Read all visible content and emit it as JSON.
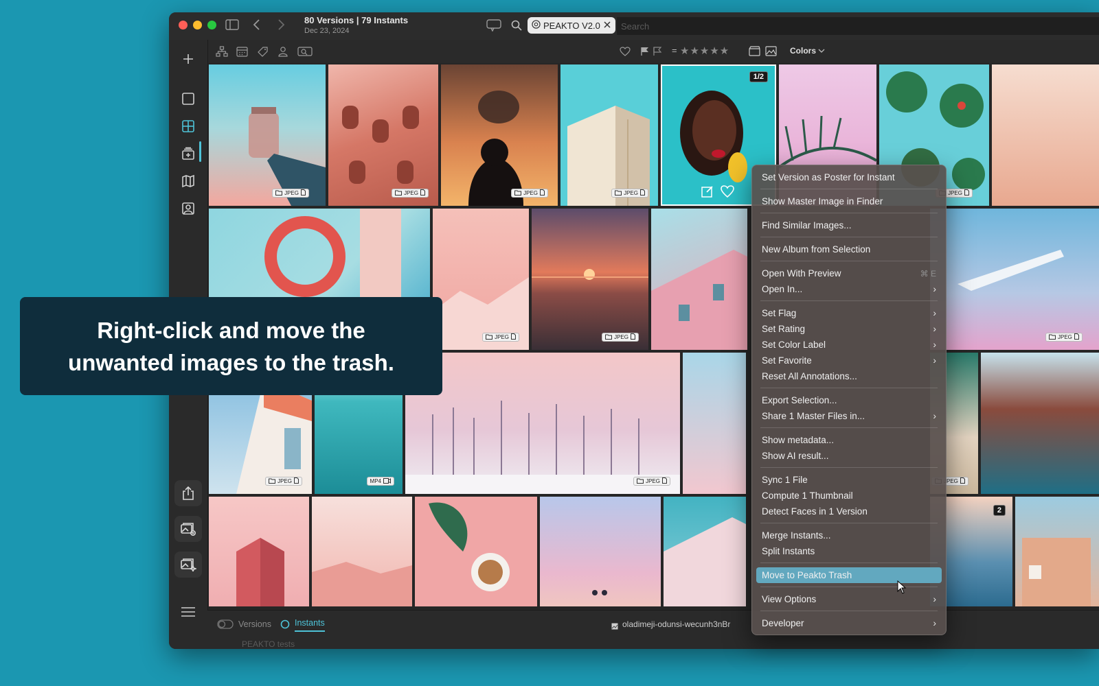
{
  "titlebar": {
    "title": "80 Versions | 79 Instants",
    "date": "Dec 23, 2024",
    "search_chip": "PEAKTO V2.0",
    "search_placeholder": "Search"
  },
  "toolbar": {
    "rating_prefix": "=",
    "stars": "★★★★★",
    "colors_label": "Colors"
  },
  "grid": {
    "badges": [
      "JPEG",
      "MP4"
    ],
    "count_badges": [
      "1/2",
      "2"
    ]
  },
  "statusbar": {
    "versions_label": "Versions",
    "instants_label": "Instants",
    "filename": "oladimeji-odunsi-wecunh3nBr",
    "behind_text": "PEAKTO tests"
  },
  "context_menu": {
    "items": [
      "Set Version as Poster for Instant",
      "Show Master Image in Finder",
      "Find Similar Images...",
      "New Album from Selection",
      "Open With Preview",
      "Open In...",
      "Set Flag",
      "Set Rating",
      "Set Color Label",
      "Set Favorite",
      "Reset All Annotations...",
      "Export Selection...",
      "Share 1 Master Files in...",
      "Show metadata...",
      "Show AI result...",
      "Sync 1 File",
      "Compute 1 Thumbnail",
      "Detect Faces in 1 Version",
      "Merge Instants...",
      "Split Instants",
      "Move to Peakto Trash",
      "View Options",
      "Developer"
    ],
    "shortcut": "⌘ E"
  },
  "callout": {
    "line1": "Right-click and move the",
    "line2": "unwanted images to the trash."
  },
  "colors": {
    "background": "#1b97b1",
    "highlight": "#62a8bf",
    "accent": "#4ec3d8"
  }
}
